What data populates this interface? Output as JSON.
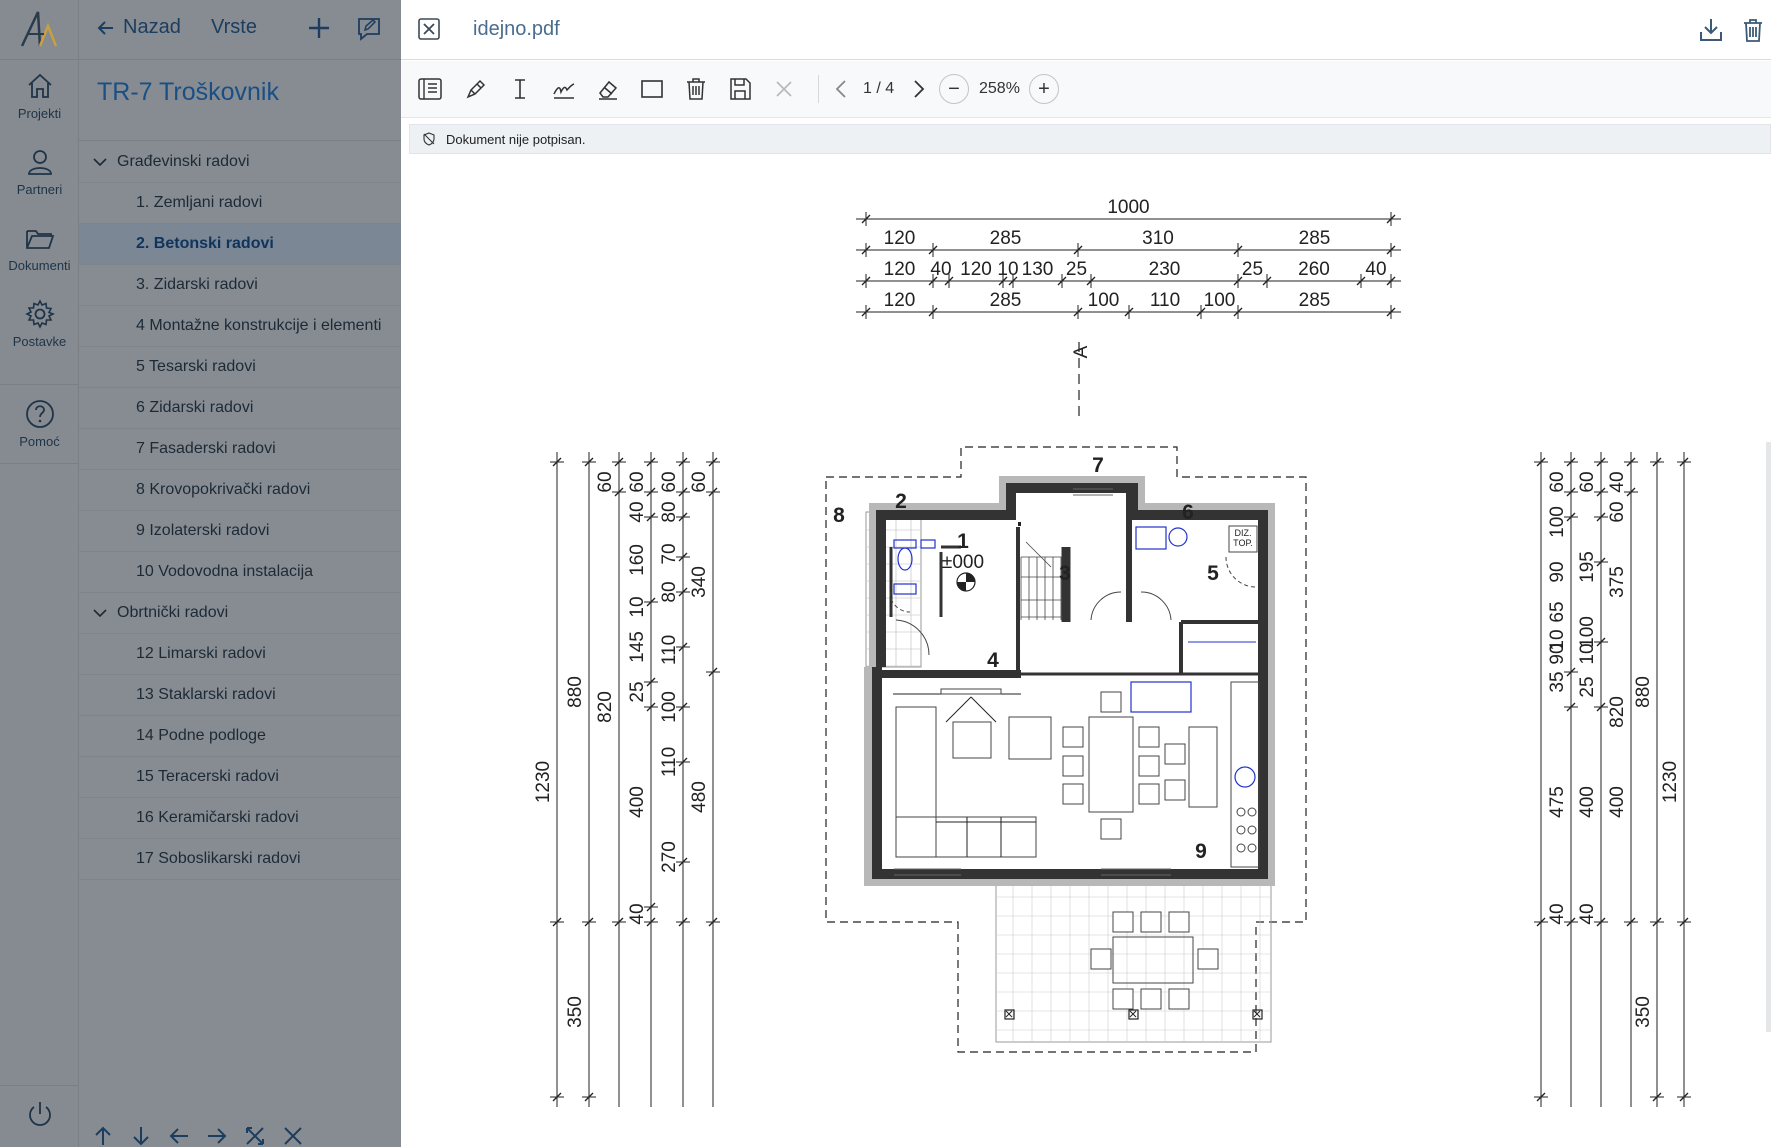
{
  "rail": {
    "items": [
      {
        "label": "Projekti",
        "icon": "home-icon"
      },
      {
        "label": "Partneri",
        "icon": "user-icon"
      },
      {
        "label": "Dokumenti",
        "icon": "folder-icon"
      },
      {
        "label": "Postavke",
        "icon": "gear-icon"
      },
      {
        "label": "Pomoć",
        "icon": "help-icon"
      }
    ]
  },
  "tree": {
    "back_label": "Nazad",
    "vrste_label": "Vrste",
    "title": "TR-7 Troškovnik",
    "rows": [
      {
        "type": "group",
        "label": "Građevinski radovi"
      },
      {
        "type": "item",
        "label": "1. Zemljani radovi"
      },
      {
        "type": "item",
        "label": "2. Betonski radovi",
        "active": true
      },
      {
        "type": "item",
        "label": "3. Zidarski radovi"
      },
      {
        "type": "item",
        "label": "4 Montažne konstrukcije i elementi"
      },
      {
        "type": "item",
        "label": "5 Tesarski radovi"
      },
      {
        "type": "item",
        "label": "6 Zidarski radovi"
      },
      {
        "type": "item",
        "label": "7 Fasaderski radovi"
      },
      {
        "type": "item",
        "label": "8 Krovopokrivački radovi"
      },
      {
        "type": "item",
        "label": "9 Izolaterski radovi"
      },
      {
        "type": "item",
        "label": "10 Vodovodna instalacija"
      },
      {
        "type": "group",
        "label": "Obrtnički radovi"
      },
      {
        "type": "item",
        "label": "12 Limarski radovi"
      },
      {
        "type": "item",
        "label": "13 Staklarski radovi"
      },
      {
        "type": "item",
        "label": "14 Podne podloge"
      },
      {
        "type": "item",
        "label": "15 Teracerski radovi"
      },
      {
        "type": "item",
        "label": "16 Keramičarski radovi"
      },
      {
        "type": "item",
        "label": "17 Soboslikarski radovi"
      }
    ]
  },
  "viewer": {
    "filename": "idejno.pdf",
    "page_indicator": "1 / 4",
    "zoom": "258%",
    "signature_status": "Dokument nije potpisan."
  },
  "plan": {
    "top_dims": {
      "total": "1000",
      "row1": [
        "120",
        "285",
        "310",
        "285"
      ],
      "row2": [
        "120",
        "40",
        "120",
        "10",
        "130",
        "25",
        "230",
        "25",
        "260",
        "40"
      ],
      "row3": [
        "120",
        "285",
        "100",
        "110",
        "100",
        "285"
      ]
    },
    "left_dims": [
      "1230",
      "880",
      "820",
      "60",
      "60",
      "40",
      "160",
      "10",
      "145",
      "25",
      "400",
      "40",
      "60",
      "80",
      "70",
      "80",
      "110",
      "100",
      "110",
      "270",
      "60",
      "340",
      "480",
      "350"
    ],
    "right_dims": [
      "60",
      "60",
      "40",
      "60",
      "100",
      "195",
      "90",
      "375",
      "65",
      "10",
      "100",
      "10",
      "35",
      "90",
      "25",
      "820",
      "880",
      "475",
      "400",
      "400",
      "40",
      "40",
      "1230",
      "350"
    ],
    "section_mark": "A",
    "rooms": [
      {
        "n": "1",
        "sub": "±000"
      },
      {
        "n": "2"
      },
      {
        "n": "3"
      },
      {
        "n": "4"
      },
      {
        "n": "5"
      },
      {
        "n": "6"
      },
      {
        "n": "7"
      },
      {
        "n": "8"
      },
      {
        "n": "9"
      }
    ],
    "diz_label": "DIZ.",
    "top_label": "TOP."
  }
}
